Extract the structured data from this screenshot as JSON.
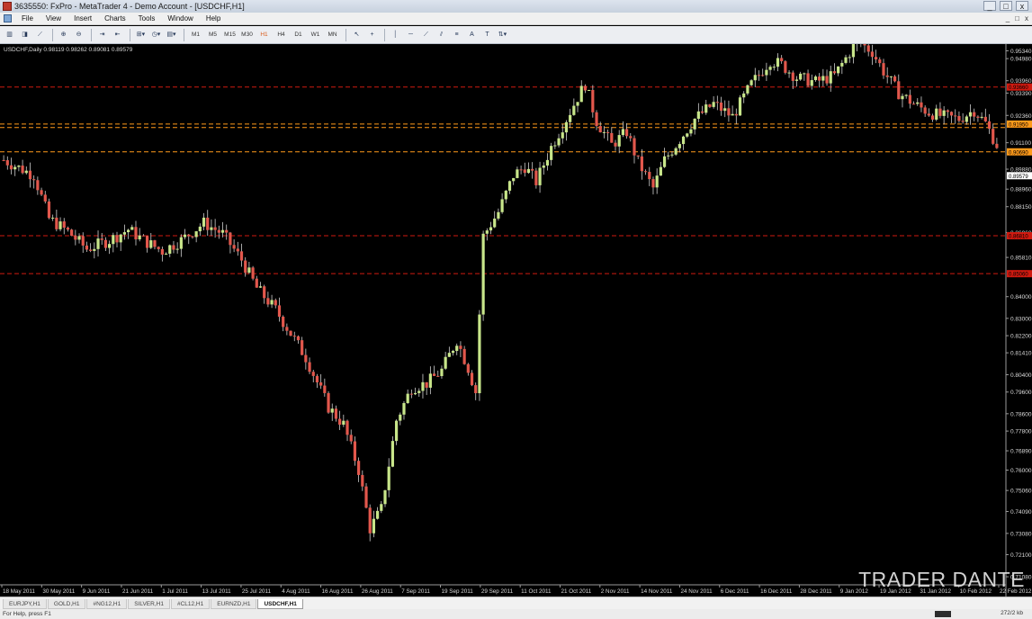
{
  "window": {
    "title": "3635550: FxPro - MetaTrader 4 - Demo Account - [USDCHF,H1]",
    "minimize": "_",
    "maximize": "□",
    "close": "x"
  },
  "menu": {
    "items": [
      "File",
      "View",
      "Insert",
      "Charts",
      "Tools",
      "Window",
      "Help"
    ],
    "right": [
      "_",
      "□",
      "x"
    ]
  },
  "toolbar": {
    "timeframes": [
      "M1",
      "M5",
      "M15",
      "M30",
      "H1",
      "H4",
      "D1",
      "W1",
      "MN"
    ]
  },
  "chart": {
    "info": "USDCHF,Daily  0.98119 0.98262 0.89081 0.89579",
    "colors": {
      "background": "#000000",
      "bull": "#c8e68a",
      "bear": "#e2574c",
      "wick": "#d0d0d0",
      "level_red": "#d01a10",
      "level_orange": "#ff9a1a",
      "price_label": "#dadada"
    }
  },
  "chart_data": {
    "type": "candlestick",
    "ylim": [
      0.7075,
      0.9565
    ],
    "price_labels": [
      "0.95340",
      "0.94980",
      "0.93960",
      "0.93390",
      "0.92360",
      "0.91100",
      "0.89880",
      "0.88960",
      "0.88150",
      "0.86960",
      "0.85810",
      "0.84000",
      "0.83000",
      "0.82200",
      "0.81410",
      "0.80400",
      "0.79600",
      "0.78600",
      "0.77800",
      "0.76890",
      "0.76000",
      "0.75060",
      "0.74090",
      "0.73080",
      "0.72100",
      "0.71080"
    ],
    "x_labels": [
      "18 May 2011",
      "30 May 2011",
      "9 Jun 2011",
      "21 Jun 2011",
      "1 Jul 2011",
      "13 Jul 2011",
      "25 Jul 2011",
      "4 Aug 2011",
      "16 Aug 2011",
      "26 Aug 2011",
      "7 Sep 2011",
      "19 Sep 2011",
      "29 Sep 2011",
      "11 Oct 2011",
      "21 Oct 2011",
      "2 Nov 2011",
      "14 Nov 2011",
      "24 Nov 2011",
      "6 Dec 2011",
      "16 Dec 2011",
      "28 Dec 2011",
      "9 Jan 2012",
      "19 Jan 2012",
      "31 Jan 2012",
      "10 Feb 2012",
      "22 Feb 2012"
    ],
    "levels": [
      {
        "price": 0.9367,
        "color": "red",
        "label": "0.93660"
      },
      {
        "price": 0.9196,
        "color": "orange",
        "label": "0.91950"
      },
      {
        "price": 0.918,
        "color": "orange",
        "label": ""
      },
      {
        "price": 0.9068,
        "color": "orange",
        "label": "0.90690"
      },
      {
        "price": 0.8681,
        "color": "red",
        "label": "0.86810"
      },
      {
        "price": 0.8506,
        "color": "red",
        "label": "0.85060"
      }
    ],
    "current_price": "0.89579",
    "anchors": [
      [
        0,
        0.903
      ],
      [
        8,
        0.896
      ],
      [
        12,
        0.876
      ],
      [
        17,
        0.87
      ],
      [
        22,
        0.862
      ],
      [
        28,
        0.866
      ],
      [
        33,
        0.871
      ],
      [
        37,
        0.866
      ],
      [
        42,
        0.861
      ],
      [
        47,
        0.866
      ],
      [
        53,
        0.874
      ],
      [
        58,
        0.869
      ],
      [
        63,
        0.857
      ],
      [
        67,
        0.844
      ],
      [
        72,
        0.834
      ],
      [
        76,
        0.823
      ],
      [
        80,
        0.812
      ],
      [
        86,
        0.789
      ],
      [
        90,
        0.781
      ],
      [
        94,
        0.76
      ],
      [
        97,
        0.733
      ],
      [
        100,
        0.742
      ],
      [
        104,
        0.783
      ],
      [
        108,
        0.798
      ],
      [
        112,
        0.8
      ],
      [
        116,
        0.806
      ],
      [
        120,
        0.82
      ],
      [
        123,
        0.807
      ],
      [
        125,
        0.796
      ],
      [
        127,
        0.868
      ],
      [
        131,
        0.879
      ],
      [
        135,
        0.896
      ],
      [
        138,
        0.9
      ],
      [
        141,
        0.893
      ],
      [
        145,
        0.909
      ],
      [
        149,
        0.922
      ],
      [
        152,
        0.932
      ],
      [
        154,
        0.938
      ],
      [
        157,
        0.921
      ],
      [
        161,
        0.91
      ],
      [
        165,
        0.916
      ],
      [
        168,
        0.902
      ],
      [
        172,
        0.89
      ],
      [
        175,
        0.903
      ],
      [
        178,
        0.91
      ],
      [
        183,
        0.922
      ],
      [
        188,
        0.929
      ],
      [
        193,
        0.923
      ],
      [
        198,
        0.938
      ],
      [
        203,
        0.949
      ],
      [
        206,
        0.947
      ],
      [
        210,
        0.941
      ],
      [
        215,
        0.939
      ],
      [
        220,
        0.942
      ],
      [
        226,
        0.958
      ],
      [
        230,
        0.953
      ],
      [
        233,
        0.944
      ],
      [
        237,
        0.934
      ],
      [
        241,
        0.929
      ],
      [
        245,
        0.925
      ],
      [
        249,
        0.923
      ],
      [
        253,
        0.922
      ],
      [
        257,
        0.926
      ],
      [
        260,
        0.92
      ],
      [
        263,
        0.91
      ]
    ]
  },
  "tabs": [
    "EURJPY,H1",
    "GOLD,H1",
    "#NG12,H1",
    "SILVER,H1",
    "#CL12,H1",
    "EURNZD,H1",
    "USDCHF,H1"
  ],
  "tabs_active_index": 6,
  "watermark": "TRADER DANTE",
  "status": {
    "left": "For Help, press F1",
    "right": "272/2 kb"
  }
}
